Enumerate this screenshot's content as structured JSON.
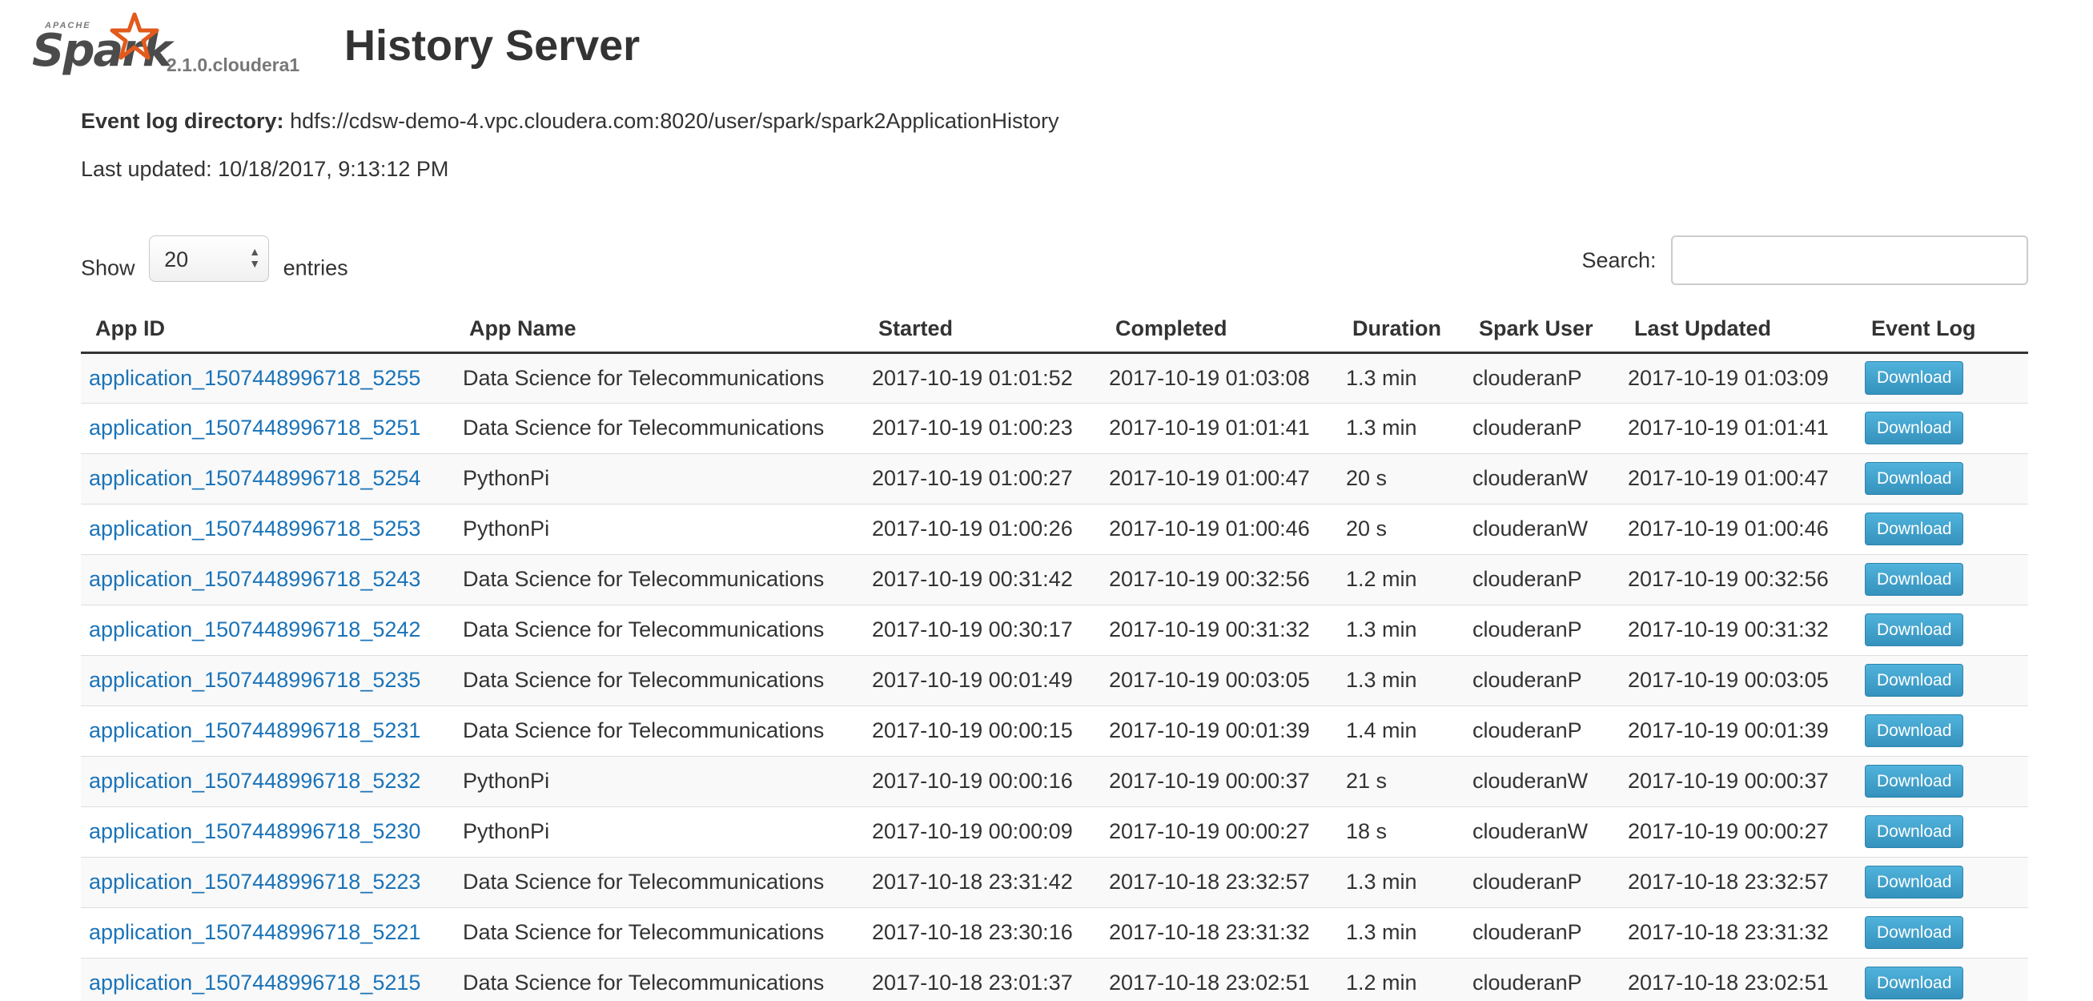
{
  "header": {
    "logo_apache": "APACHE",
    "logo_spark": "Spark",
    "version": "2.1.0.cloudera1",
    "title": "History Server"
  },
  "info": {
    "event_log_label": "Event log directory:",
    "event_log_value": "hdfs://cdsw-demo-4.vpc.cloudera.com:8020/user/spark/spark2ApplicationHistory",
    "last_updated": "Last updated: 10/18/2017, 9:13:12 PM"
  },
  "controls": {
    "show_label": "Show",
    "entries_label": "entries",
    "page_size": "20",
    "search_label": "Search:",
    "search_value": ""
  },
  "table": {
    "columns": [
      "App ID",
      "App Name",
      "Started",
      "Completed",
      "Duration",
      "Spark User",
      "Last Updated",
      "Event Log"
    ],
    "download_label": "Download",
    "rows": [
      [
        "application_1507448996718_5255",
        "Data Science for Telecommunications",
        "2017-10-19 01:01:52",
        "2017-10-19 01:03:08",
        "1.3 min",
        "clouderanP",
        "2017-10-19 01:03:09"
      ],
      [
        "application_1507448996718_5251",
        "Data Science for Telecommunications",
        "2017-10-19 01:00:23",
        "2017-10-19 01:01:41",
        "1.3 min",
        "clouderanP",
        "2017-10-19 01:01:41"
      ],
      [
        "application_1507448996718_5254",
        "PythonPi",
        "2017-10-19 01:00:27",
        "2017-10-19 01:00:47",
        "20 s",
        "clouderanW",
        "2017-10-19 01:00:47"
      ],
      [
        "application_1507448996718_5253",
        "PythonPi",
        "2017-10-19 01:00:26",
        "2017-10-19 01:00:46",
        "20 s",
        "clouderanW",
        "2017-10-19 01:00:46"
      ],
      [
        "application_1507448996718_5243",
        "Data Science for Telecommunications",
        "2017-10-19 00:31:42",
        "2017-10-19 00:32:56",
        "1.2 min",
        "clouderanP",
        "2017-10-19 00:32:56"
      ],
      [
        "application_1507448996718_5242",
        "Data Science for Telecommunications",
        "2017-10-19 00:30:17",
        "2017-10-19 00:31:32",
        "1.3 min",
        "clouderanP",
        "2017-10-19 00:31:32"
      ],
      [
        "application_1507448996718_5235",
        "Data Science for Telecommunications",
        "2017-10-19 00:01:49",
        "2017-10-19 00:03:05",
        "1.3 min",
        "clouderanP",
        "2017-10-19 00:03:05"
      ],
      [
        "application_1507448996718_5231",
        "Data Science for Telecommunications",
        "2017-10-19 00:00:15",
        "2017-10-19 00:01:39",
        "1.4 min",
        "clouderanP",
        "2017-10-19 00:01:39"
      ],
      [
        "application_1507448996718_5232",
        "PythonPi",
        "2017-10-19 00:00:16",
        "2017-10-19 00:00:37",
        "21 s",
        "clouderanW",
        "2017-10-19 00:00:37"
      ],
      [
        "application_1507448996718_5230",
        "PythonPi",
        "2017-10-19 00:00:09",
        "2017-10-19 00:00:27",
        "18 s",
        "clouderanW",
        "2017-10-19 00:00:27"
      ],
      [
        "application_1507448996718_5223",
        "Data Science for Telecommunications",
        "2017-10-18 23:31:42",
        "2017-10-18 23:32:57",
        "1.3 min",
        "clouderanP",
        "2017-10-18 23:32:57"
      ],
      [
        "application_1507448996718_5221",
        "Data Science for Telecommunications",
        "2017-10-18 23:30:16",
        "2017-10-18 23:31:32",
        "1.3 min",
        "clouderanP",
        "2017-10-18 23:31:32"
      ],
      [
        "application_1507448996718_5215",
        "Data Science for Telecommunications",
        "2017-10-18 23:01:37",
        "2017-10-18 23:02:51",
        "1.2 min",
        "clouderanP",
        "2017-10-18 23:02:51"
      ]
    ]
  },
  "colors": {
    "link": "#1a73b8",
    "download_button": "#3fa4cd",
    "logo_star": "#e25a1c"
  },
  "icons": {
    "logo_star": "spark-star-icon",
    "select_arrows": "up-down-arrows-icon"
  }
}
